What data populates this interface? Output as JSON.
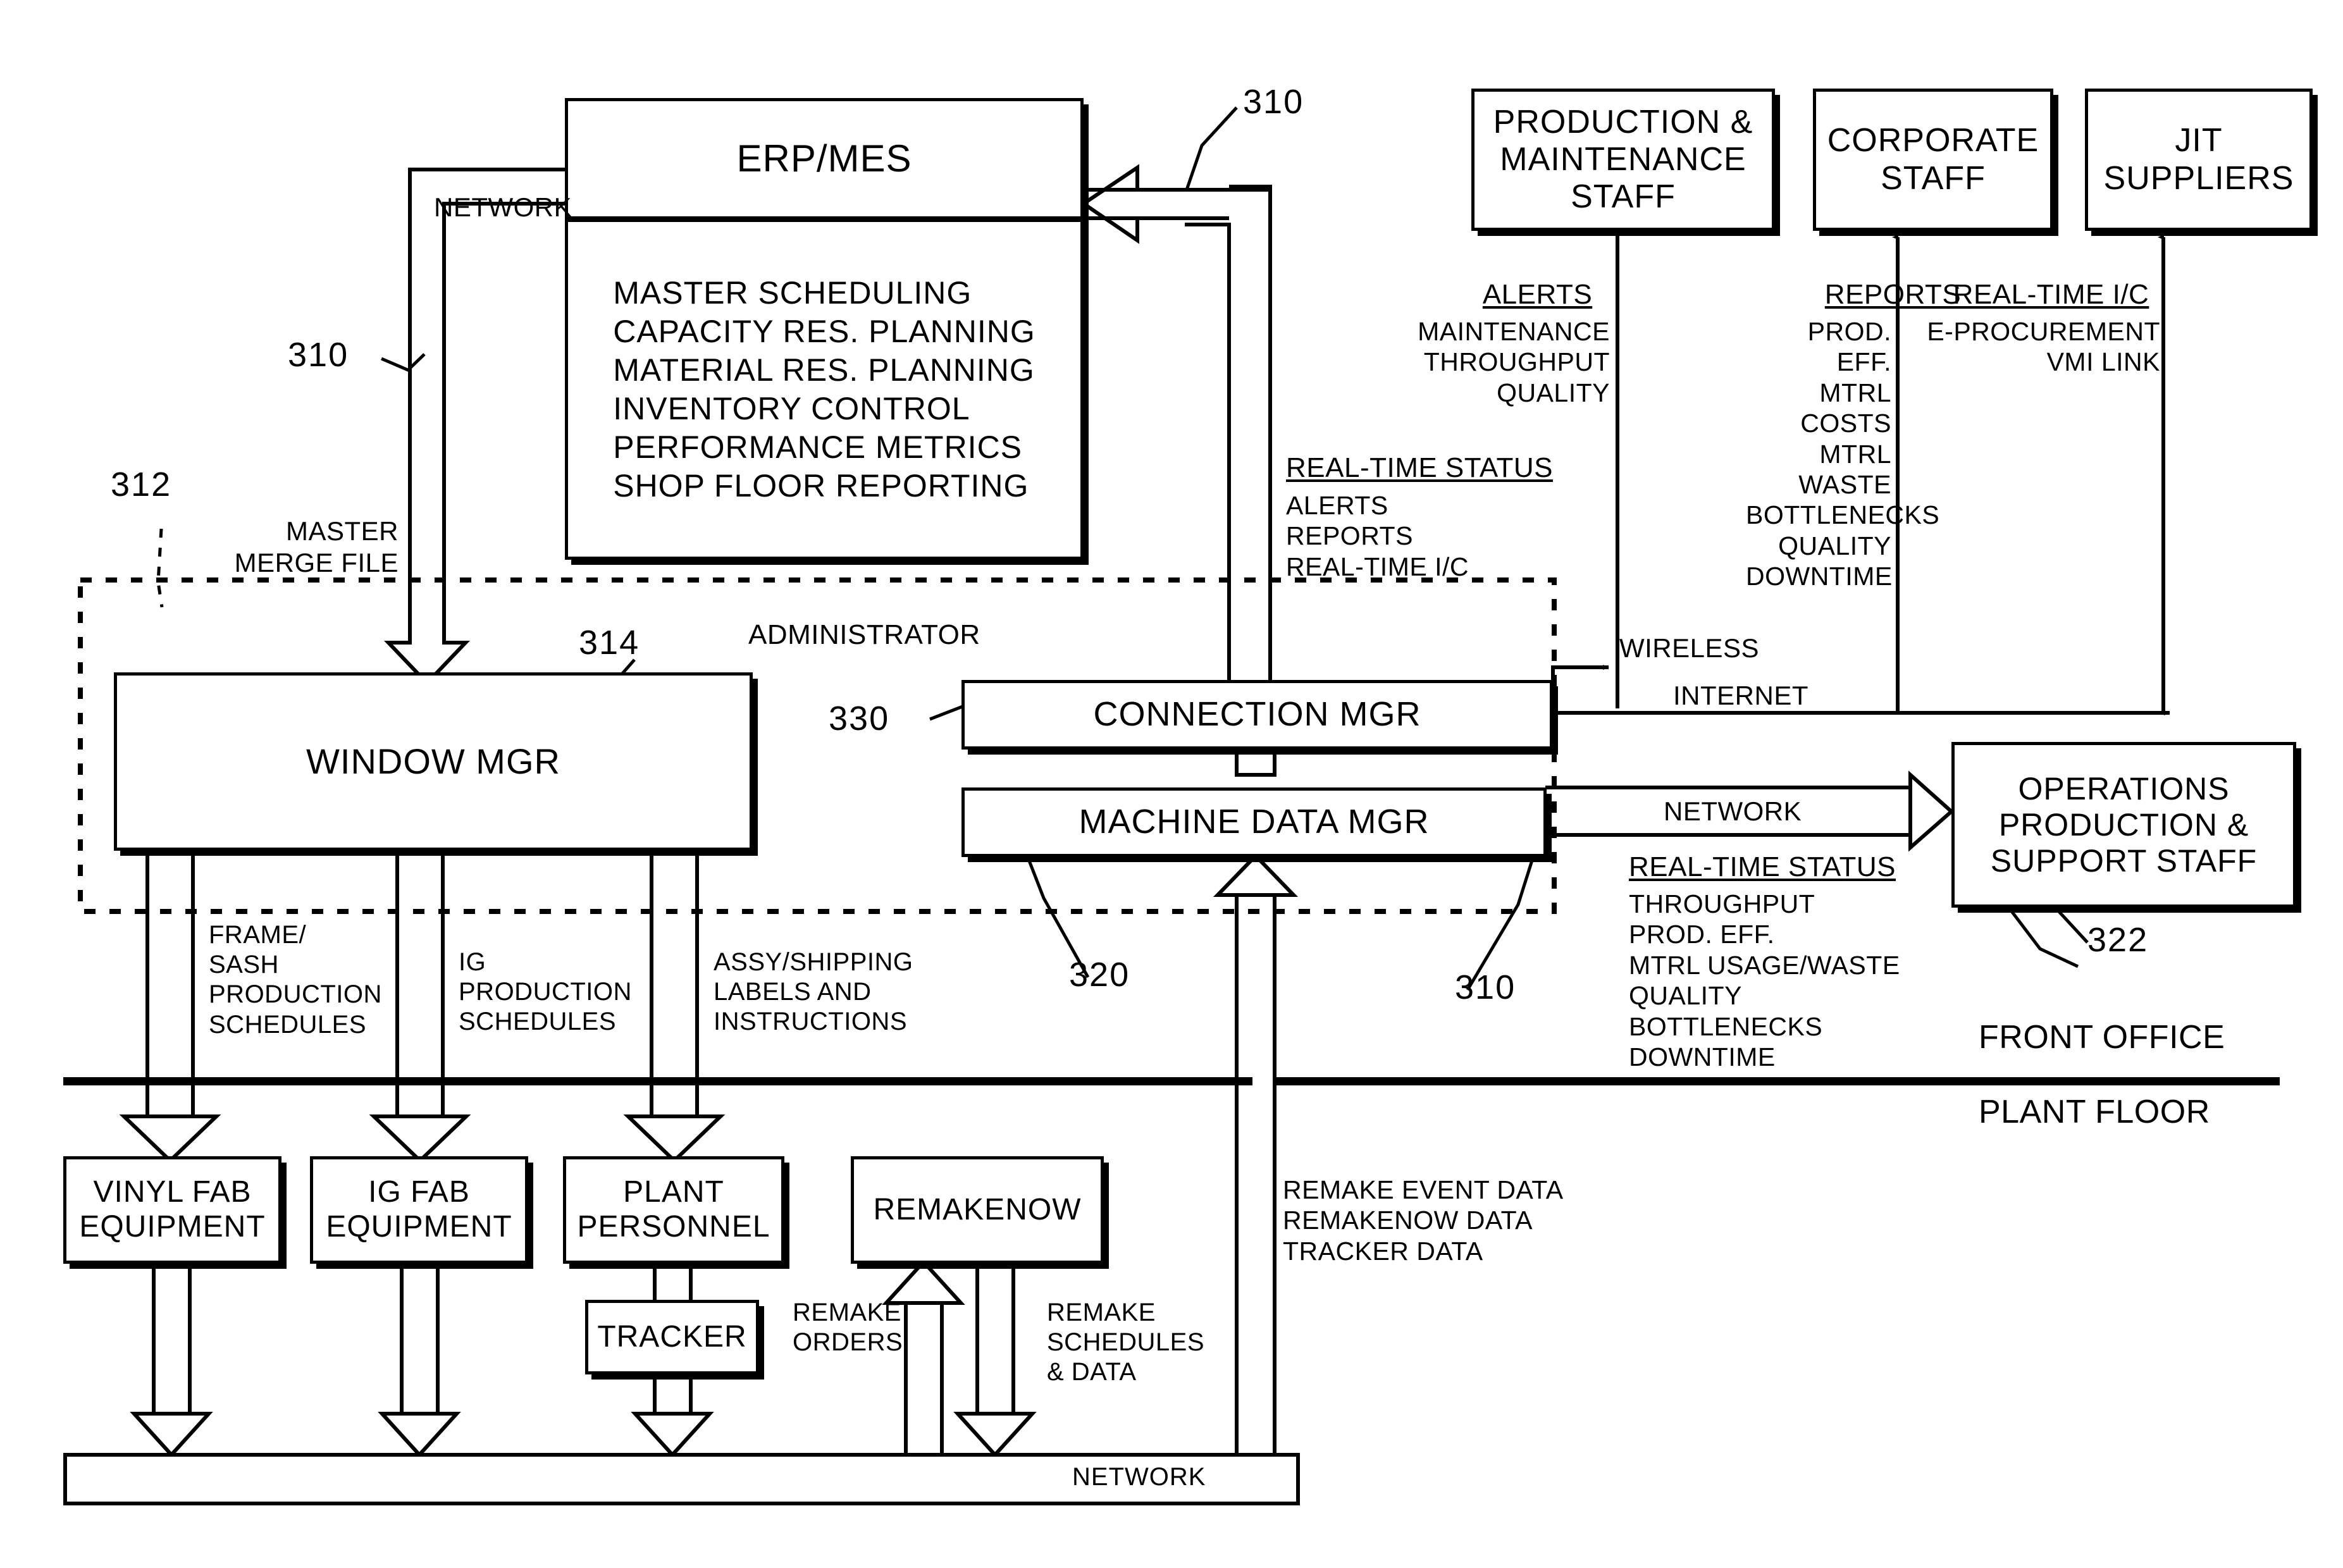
{
  "figure": {
    "erp": {
      "title": "ERP/MES",
      "functions": "MASTER SCHEDULING\nCAPACITY RES. PLANNING\nMATERIAL RES. PLANNING\nINVENTORY CONTROL\nPERFORMANCE METRICS\nSHOP FLOOR REPORTING"
    },
    "boxes": {
      "production_maintenance_staff": "PRODUCTION &\nMAINTENANCE\nSTAFF",
      "corporate_staff": "CORPORATE\nSTAFF",
      "jit_suppliers": "JIT\nSUPPLIERS",
      "window_mgr": "WINDOW MGR",
      "connection_mgr": "CONNECTION MGR",
      "machine_data_mgr": "MACHINE DATA MGR",
      "operations_staff": "OPERATIONS\nPRODUCTION &\nSUPPORT STAFF",
      "vinyl_fab": "VINYL FAB\nEQUIPMENT",
      "ig_fab": "IG FAB\nEQUIPMENT",
      "plant_personnel": "PLANT\nPERSONNEL",
      "remakenow": "REMAKENOW",
      "tracker": "TRACKER"
    },
    "reference_numerals": {
      "n310_top_left": "310",
      "n310_top_right": "310",
      "n312": "312",
      "n314": "314",
      "n320": "320",
      "n322": "322",
      "n330": "330",
      "n310_mid_right": "310"
    },
    "labels": {
      "network_top": "NETWORK",
      "master_merge_file": "MASTER\nMERGE FILE",
      "administrator": "ADMINISTRATOR",
      "alerts_heading": "ALERTS",
      "alerts_items": "MAINTENANCE\nTHROUGHPUT\nQUALITY",
      "reports_heading": "REPORTS",
      "reports_items": "PROD. EFF.\nMTRL COSTS\nMTRL WASTE\nBOTTLENECKS\nQUALITY\nDOWNTIME",
      "realtime_ic_heading": "REAL-TIME I/C",
      "realtime_ic_items": "E-PROCUREMENT\nVMI LINK",
      "realtime_status_heading_left": "REAL-TIME STATUS",
      "realtime_status_items_left": "ALERTS\nREPORTS\nREAL-TIME I/C",
      "wireless": "WIRELESS",
      "internet": "INTERNET",
      "network_right": "NETWORK",
      "realtime_status_heading_right": "REAL-TIME STATUS",
      "realtime_status_items_right": "THROUGHPUT\nPROD. EFF.\nMTRL USAGE/WASTE\nQUALITY\nBOTTLENECKS\nDOWNTIME",
      "frame_sash": "FRAME/\nSASH\nPRODUCTION\nSCHEDULES",
      "ig_schedules": "IG\nPRODUCTION\nSCHEDULES",
      "assy_shipping": "ASSY/SHIPPING\nLABELS AND\nINSTRUCTIONS",
      "front_office": "FRONT OFFICE",
      "plant_floor": "PLANT FLOOR",
      "remake_orders": "REMAKE\nORDERS",
      "remake_schedules": "REMAKE\nSCHEDULES\n& DATA",
      "remake_event_data": "REMAKE EVENT DATA\nREMAKENOW DATA\nTRACKER DATA",
      "network_bottom": "NETWORK"
    },
    "colors": {
      "line": "#000000",
      "background": "#ffffff"
    }
  }
}
